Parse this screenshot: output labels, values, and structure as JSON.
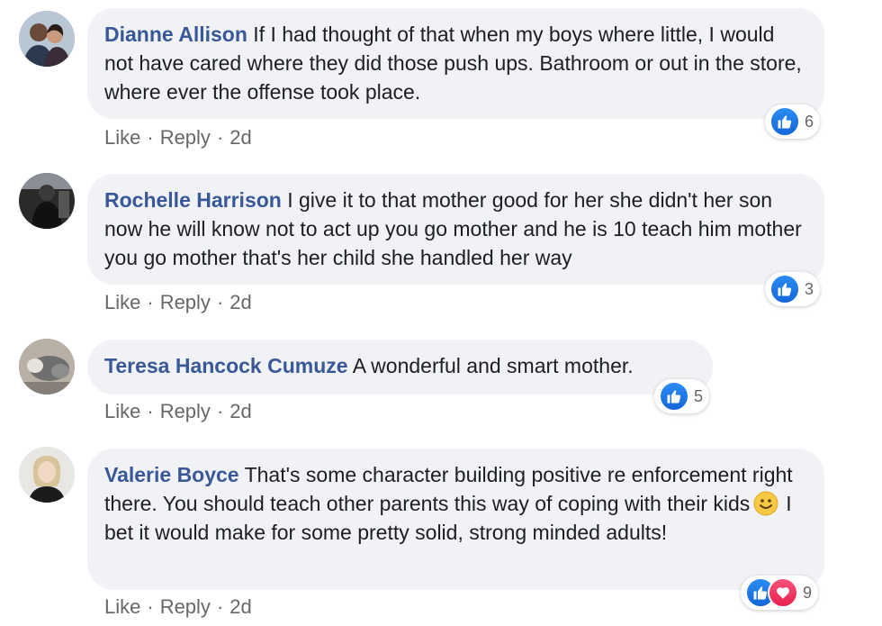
{
  "comments": [
    {
      "author": "Dianne Allison",
      "text": "If I had thought of that when my boys where little, I would not have cared where they did those push ups. Bathroom or out in the store, where ever the offense took place.",
      "like_label": "Like",
      "reply_label": "Reply",
      "time": "2d",
      "reaction_count": "6",
      "reaction_icons": [
        "like-icon"
      ]
    },
    {
      "author": "Rochelle Harrison",
      "text": "I give it to that mother good for her she didn't her son now he will know not to act up you go mother and he is 10 teach him mother you go mother that's her child she handled her way",
      "like_label": "Like",
      "reply_label": "Reply",
      "time": "2d",
      "reaction_count": "3",
      "reaction_icons": [
        "like-icon"
      ]
    },
    {
      "author": "Teresa Hancock Cumuze",
      "text": "A wonderful and smart mother.",
      "like_label": "Like",
      "reply_label": "Reply",
      "time": "2d",
      "reaction_count": "5",
      "reaction_icons": [
        "like-icon"
      ]
    },
    {
      "author": "Valerie Boyce",
      "text_before": "That's some character building positive re enforcement right there. You should teach other parents this way of coping with their kids",
      "emoji": "smile-emoji",
      "text_after": "I bet it would make for some pretty solid, strong minded adults!",
      "like_label": "Like",
      "reply_label": "Reply",
      "time": "2d",
      "reaction_count": "9",
      "reaction_icons": [
        "like-icon",
        "love-icon"
      ]
    }
  ],
  "separator": "·",
  "colors": {
    "author": "#385898",
    "bubble": "#f0f2f5",
    "meta": "#65676b",
    "like": "#1877f2",
    "love": "#f33e58"
  }
}
